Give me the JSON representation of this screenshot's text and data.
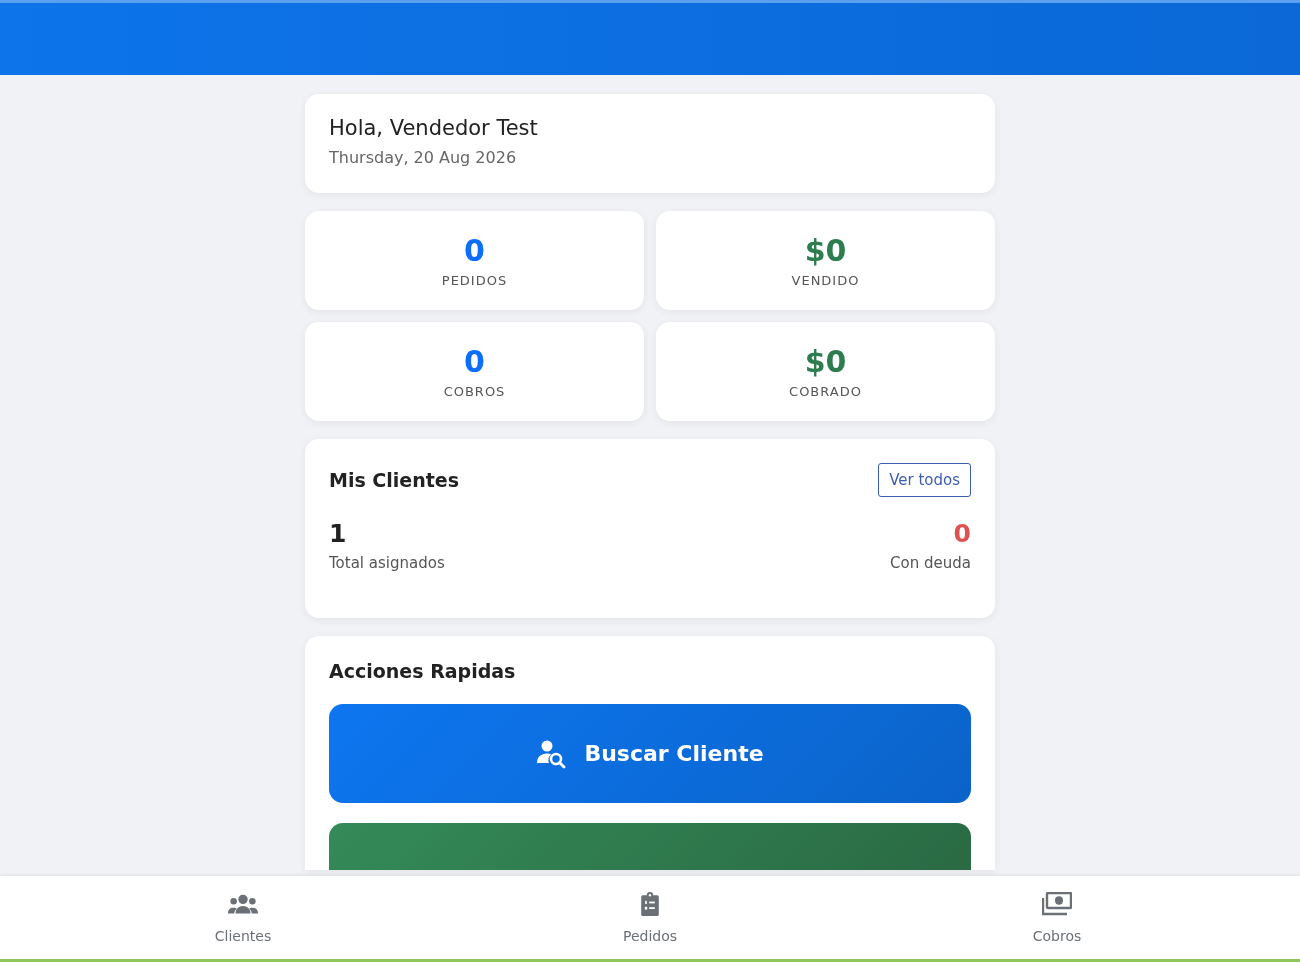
{
  "greeting": {
    "title": "Hola, Vendedor Test",
    "date": "Thursday, 20 Aug 2026"
  },
  "stats": [
    {
      "kind": "count",
      "value": "0",
      "label": "PEDIDOS"
    },
    {
      "kind": "money",
      "value": "$0",
      "label": "VENDIDO"
    },
    {
      "kind": "count",
      "value": "0",
      "label": "COBROS"
    },
    {
      "kind": "money",
      "value": "$0",
      "label": "COBRADO"
    }
  ],
  "clients": {
    "title": "Mis Clientes",
    "link": "Ver todos",
    "total": {
      "value": "1",
      "label": "Total asignados"
    },
    "debt": {
      "value": "0",
      "label": "Con deuda"
    }
  },
  "actions": {
    "title": "Acciones Rapidas",
    "buttons": [
      {
        "kind": "primary",
        "label": "Buscar Cliente"
      },
      {
        "kind": "success"
      }
    ]
  },
  "nav": [
    {
      "label": "Clientes"
    },
    {
      "label": "Pedidos"
    },
    {
      "label": "Cobros"
    }
  ]
}
